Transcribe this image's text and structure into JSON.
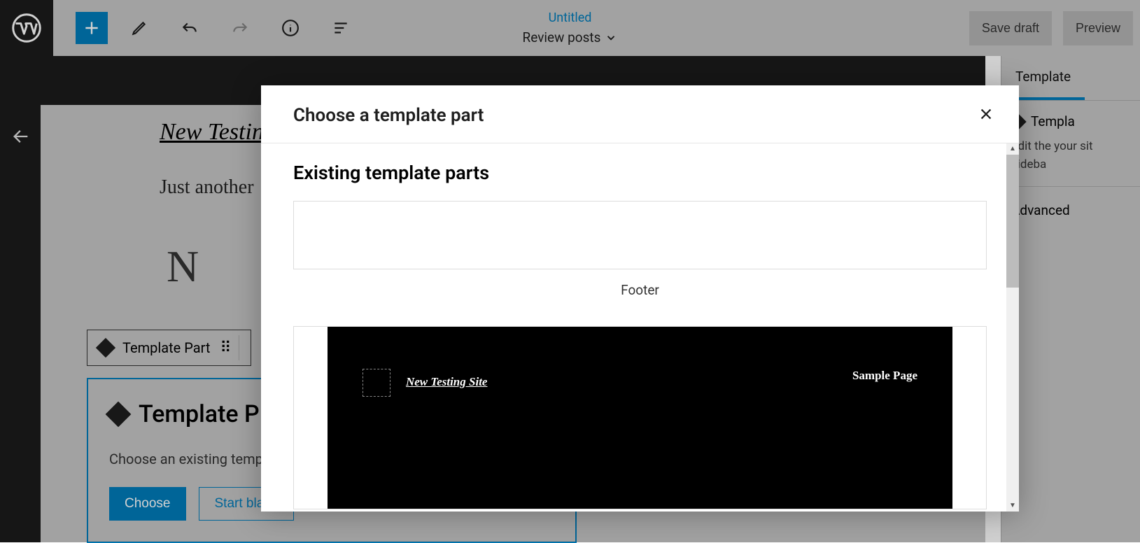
{
  "toolbar": {
    "doc_title": "Untitled",
    "doc_context": "Review posts",
    "save_draft": "Save draft",
    "preview": "Preview"
  },
  "back_bar": {
    "back": "Back"
  },
  "canvas": {
    "site_title": "New Testing",
    "tagline": "Just another",
    "big_letters": "N   T",
    "block_toolbar_label": "Template Part"
  },
  "placeholder": {
    "title": "Template P",
    "desc": "Choose an existing templat",
    "choose": "Choose",
    "start_blank": "Start blank"
  },
  "sidebar": {
    "tab": "Template",
    "block_name": "Templa",
    "block_desc": "Edit the\nyour sit\nsideba",
    "advanced": "Advanced"
  },
  "modal": {
    "title": "Choose a template part",
    "section": "Existing template parts",
    "parts": [
      {
        "name": "Footer"
      }
    ],
    "header_preview": {
      "site_name": "New Testing Site",
      "nav_item": "Sample Page"
    }
  },
  "colors": {
    "accent": "#007cba"
  }
}
